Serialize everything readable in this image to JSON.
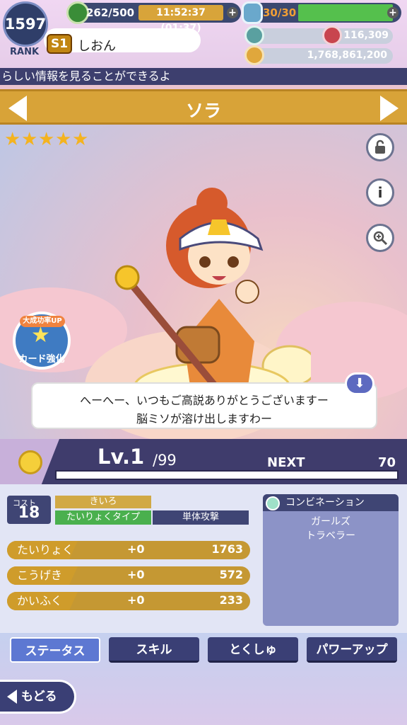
{
  "header": {
    "rank": "1597",
    "rank_label": "RANK",
    "title_badge": "S1",
    "player_name": "しおん",
    "stamina": "262/500",
    "timer": "11:52:37 (01:37)",
    "potion": "30/30",
    "gems": "0",
    "rubies": "116,309",
    "coins": "1,768,861,200"
  },
  "ticker": "らしい情報を見ることができるよ",
  "card": {
    "name": "ソラ",
    "stars": [
      "★",
      "★",
      "★",
      "★",
      "★"
    ],
    "speech_line1": "へーへー、いつもご高説ありがとうございますー",
    "speech_line2": "脳ミソが溶け出しますわー",
    "enhance_top": "大成功率UP",
    "enhance_label": "カード強化",
    "info_button": "i"
  },
  "level": {
    "label": "Lv.1",
    "max": "/99",
    "next_label": "NEXT",
    "next_value": "70",
    "exp_progress": 0
  },
  "stats": {
    "cost_label": "コスト",
    "cost_value": "18",
    "color": "きいろ",
    "type": "たいりょくタイプ",
    "attack": "単体攻撃",
    "rows": [
      {
        "name": "たいりょく",
        "bonus": "+0",
        "value": "1763"
      },
      {
        "name": "こうげき",
        "bonus": "+0",
        "value": "572"
      },
      {
        "name": "かいふく",
        "bonus": "+0",
        "value": "233"
      }
    ],
    "combination_title": "コンビネーション",
    "combinations": [
      "ガールズ",
      "トラベラー"
    ]
  },
  "tabs": [
    "ステータス",
    "スキル",
    "とくしゅ",
    "パワーアップ"
  ],
  "back_label": "もどる",
  "colors": {
    "title_banner": "#d8a338",
    "panel_dark": "#3f4574",
    "stat_gold": "#c59833",
    "type_green": "#4ab04e"
  }
}
